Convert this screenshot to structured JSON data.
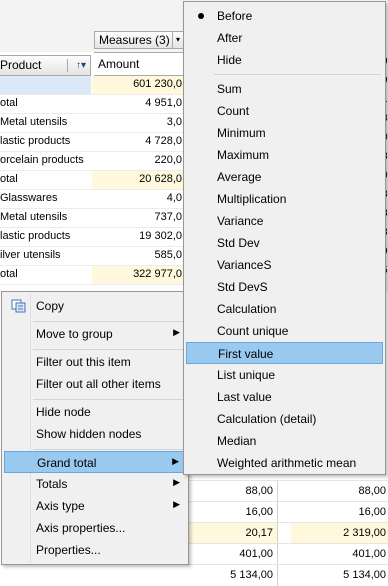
{
  "toolbar": {
    "measures_label": "Measures (3)",
    "measures_arrow": "▾"
  },
  "grid": {
    "product_header": "Product",
    "sort_icon": "↑▾",
    "amount_header": "Amount",
    "rows": [
      {
        "label": "",
        "value": "601 230,0"
      },
      {
        "label": "otal",
        "value": "4 951,0"
      },
      {
        "label": "Metal utensils",
        "value": "3,0"
      },
      {
        "label": "lastic products",
        "value": "4 728,0"
      },
      {
        "label": "orcelain products",
        "value": "220,0"
      },
      {
        "label": "otal",
        "value": "20 628,0"
      },
      {
        "label": "Glasswares",
        "value": "4,0"
      },
      {
        "label": "Metal utensils",
        "value": "737,0"
      },
      {
        "label": "lastic products",
        "value": "19 302,0"
      },
      {
        "label": "ilver utensils",
        "value": "585,0"
      },
      {
        "label": "otal",
        "value": "322 977,0"
      }
    ],
    "right_strip": [
      "9",
      "9",
      "1",
      "8",
      "0",
      "8",
      "0",
      "3",
      "8",
      "8",
      "9",
      "5"
    ],
    "bottom_rows": [
      {
        "c1": "88,00",
        "c2": "88,00"
      },
      {
        "c1": "16,00",
        "c2": "16,00"
      },
      {
        "c1": "20,17",
        "c2": "2 319,00"
      },
      {
        "c1": "401,00",
        "c2": "401,00"
      },
      {
        "c1": "5 134,00",
        "c2": "5 134,00"
      }
    ]
  },
  "context_menu": {
    "copy": "Copy",
    "move_to_group": "Move to group",
    "filter_out_item": "Filter out this item",
    "filter_out_others": "Filter out all other items",
    "hide_node": "Hide node",
    "show_hidden": "Show hidden nodes",
    "grand_total": "Grand total",
    "totals": "Totals",
    "axis_type": "Axis type",
    "axis_properties": "Axis properties...",
    "properties": "Properties...",
    "submenu_arrow": "▶"
  },
  "submenu": {
    "items": [
      "Before",
      "After",
      "Hide",
      "Sum",
      "Count",
      "Minimum",
      "Maximum",
      "Average",
      "Multiplication",
      "Variance",
      "Std Dev",
      "VarianceS",
      "Std DevS",
      "Calculation",
      "Count unique",
      "First value",
      "List unique",
      "Last value",
      "Calculation (detail)",
      "Median",
      "Weighted arithmetic mean"
    ],
    "checked": "Before",
    "highlighted": "First value"
  }
}
